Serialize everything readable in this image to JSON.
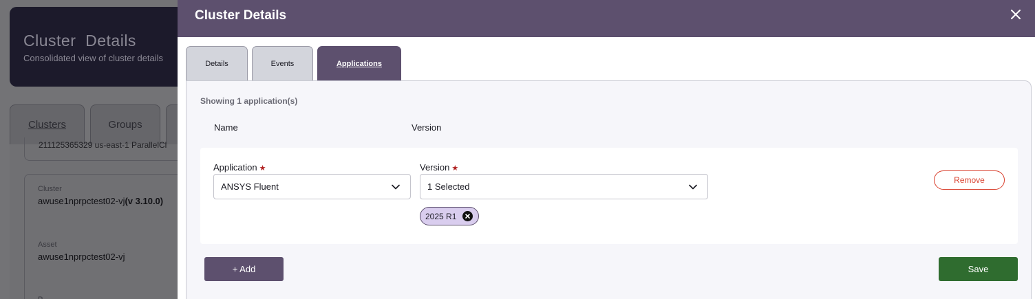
{
  "background": {
    "title": "Cluster  Details",
    "subtitle": "Consolidated view of cluster details",
    "tabs": [
      "Clusters",
      "Groups"
    ],
    "card1_text": "211125365329 us-east-1 ParallelCl",
    "cluster_label": "Cluster",
    "cluster_value": "awuse1nprpctest02-vj",
    "cluster_version": "(v 3.10.0)",
    "asset_label": "Asset",
    "asset_value": "awuse1nprpctest02-vj",
    "partial_label": "P"
  },
  "drawer": {
    "title": "Cluster Details",
    "close_icon": "close-icon",
    "header_color": "#5d506e",
    "tabs": [
      {
        "label": "Details",
        "active": false
      },
      {
        "label": "Events",
        "active": false
      },
      {
        "label": "Applications",
        "active": true
      }
    ],
    "applications": {
      "showing_text": "Showing 1 application(s)",
      "columns": {
        "name": "Name",
        "version": "Version"
      },
      "rows": [
        {
          "application_label": "Application",
          "application_value": "ANSYS Fluent",
          "version_label": "Version",
          "version_value": "1 Selected",
          "chips": [
            "2025 R1"
          ],
          "remove_label": "Remove"
        }
      ],
      "add_label": "+ Add",
      "save_label": "Save",
      "save_color": "#2f6c2f",
      "remove_color": "#d9402e"
    }
  }
}
